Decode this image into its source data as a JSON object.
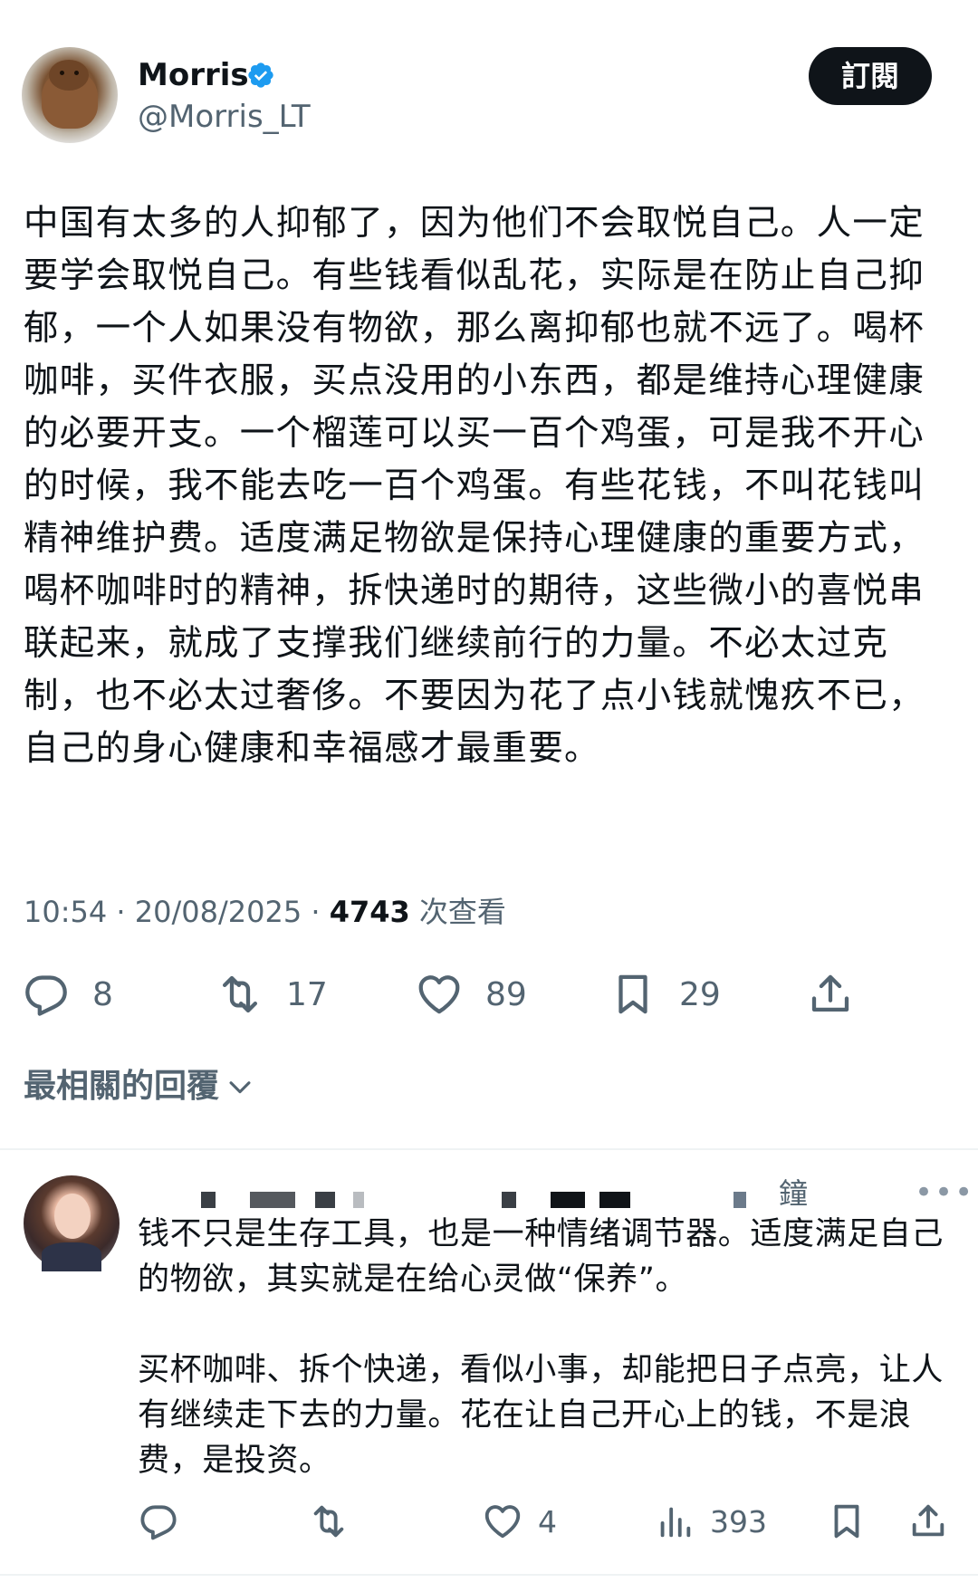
{
  "post": {
    "author": {
      "name": "Morris",
      "handle": "@Morris_LT",
      "verified": true
    },
    "subscribe_label": "訂閱",
    "text": "中国有太多的人抑郁了，因为他们不会取悦自己。人一定要学会取悦自己。有些钱看似乱花，实际是在防止自己抑郁，一个人如果没有物欲，那么离抑郁也就不远了。喝杯咖啡，买件衣服，买点没用的小东西，都是维持心理健康的必要开支。一个榴莲可以买一百个鸡蛋，可是我不开心的时候，我不能去吃一百个鸡蛋。有些花钱，不叫花钱叫精神维护费。适度满足物欲是保持心理健康的重要方式，喝杯咖啡时的精神，拆快递时的期待，这些微小的喜悦串联起来，就成了支撑我们继续前行的力量。不必太过克制，也不必太过奢侈。不要因为花了点小钱就愧疚不已，自己的身心健康和幸福感才最重要。",
    "meta": {
      "time": "10:54",
      "date": "20/08/2025",
      "views": "4743",
      "views_label": "次查看"
    },
    "actions": {
      "replies": "8",
      "reposts": "17",
      "likes": "89",
      "bookmarks": "29"
    }
  },
  "replies_sort_label": "最相關的回覆",
  "reply": {
    "name_visible_char": "鐘",
    "text": "钱不只是生存工具，也是一种情绪调节器。适度满足自己的物欲，其实就是在给心灵做“保养”。\n\n买杯咖啡、拆个快递，看似小事，却能把日子点亮，让人有继续走下去的力量。花在让自己开心上的钱，不是浪费，是投资。",
    "actions": {
      "likes": "4",
      "views": "393"
    }
  },
  "icons": {
    "reply": "speech-bubble-icon",
    "repost": "repost-arrows-icon",
    "like": "heart-icon",
    "bookmark": "bookmark-icon",
    "share": "share-upload-icon",
    "views": "bar-chart-icon",
    "verified": "verified-badge-icon",
    "chevron": "chevron-down-icon",
    "more": "more-dots-icon"
  },
  "colors": {
    "verified": "#1d9bf0",
    "secondary_text": "#536471",
    "button_bg": "#0f1419"
  }
}
